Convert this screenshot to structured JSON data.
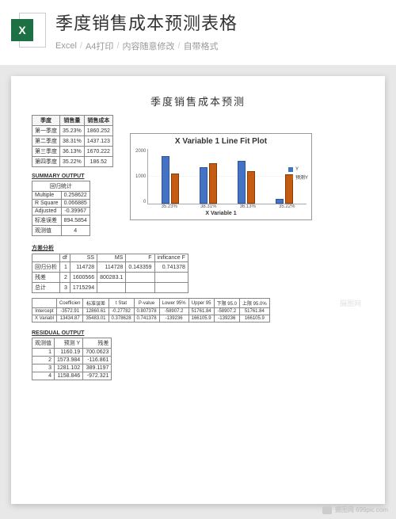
{
  "header": {
    "excel_letter": "X",
    "title": "季度销售成本预测表格",
    "sub1": "Excel",
    "sub2": "A4打印",
    "sub3": "内容随意修改",
    "sub4": "自带格式"
  },
  "sheet": {
    "title": "季度销售成本预测",
    "data_headers": {
      "c1": "季度",
      "c2": "销售量",
      "c3": "销售成本"
    },
    "rows": [
      {
        "q": "第一季度",
        "v": "35.23%",
        "c": "1860.252"
      },
      {
        "q": "第二季度",
        "v": "38.31%",
        "c": "1437.123"
      },
      {
        "q": "第三季度",
        "v": "36.13%",
        "c": "1670.222"
      },
      {
        "q": "第四季度",
        "v": "35.22%",
        "c": "186.52"
      }
    ],
    "summary_h": "SUMMARY OUTPUT",
    "reg_h": "回归统计",
    "reg": [
      {
        "k": "Multiple",
        "v": "0.258622"
      },
      {
        "k": "R Square",
        "v": "0.066885"
      },
      {
        "k": "Adjusted",
        "v": "-0.39967"
      },
      {
        "k": "标准误差",
        "v": "894.5854"
      },
      {
        "k": "观测值",
        "v": "4"
      }
    ],
    "anova_h": "方差分析",
    "anova_headers": {
      "c1": "",
      "c2": "df",
      "c3": "SS",
      "c4": "MS",
      "c5": "F",
      "c6": "inificance F"
    },
    "anova": [
      {
        "n": "回归分析",
        "df": "1",
        "ss": "114728",
        "ms": "114728",
        "f": "0.143359",
        "sig": "0.741378"
      },
      {
        "n": "残差",
        "df": "2",
        "ss": "1600566",
        "ms": "800283.1",
        "f": "",
        "sig": ""
      },
      {
        "n": "总计",
        "df": "3",
        "ss": "1715294",
        "ms": "",
        "f": "",
        "sig": ""
      }
    ],
    "coef_headers": {
      "c1": "",
      "c2": "Coefficien",
      "c3": "标准误差",
      "c4": "t Stat",
      "c5": "P-value",
      "c6": "Lower 95%",
      "c7": "Upper 95",
      "c8": "下限 95.0",
      "c9": "上限 95.0%"
    },
    "coef": [
      {
        "n": "Intercept",
        "a": "-3572.91",
        "b": "12860.61",
        "c": "-0.27782",
        "d": "0.807378",
        "e": "-58907.2",
        "f": "51761.84",
        "g": "-58907.2",
        "h": "51761.84"
      },
      {
        "n": "X Variabl",
        "a": "13434.87",
        "b": "35483.01",
        "c": "0.378628",
        "d": "0.741378",
        "e": "-139236",
        "f": "166105.9",
        "g": "-139236",
        "h": "166105.9"
      }
    ],
    "resid_h": "RESIDUAL OUTPUT",
    "resid_headers": {
      "c1": "观测值",
      "c2": "预测 Y",
      "c3": "残差"
    },
    "resid": [
      {
        "o": "1",
        "p": "1160.19",
        "r": "700.0623"
      },
      {
        "o": "2",
        "p": "1573.984",
        "r": "-116.861"
      },
      {
        "o": "3",
        "p": "1281.102",
        "r": "389.1197"
      },
      {
        "o": "4",
        "p": "1158.846",
        "r": "-972.321"
      }
    ]
  },
  "chart_data": {
    "type": "bar",
    "title": "X Variable 1 Line Fit  Plot",
    "categories": [
      "35.23%",
      "38.31%",
      "36.13%",
      "35.22%"
    ],
    "series": [
      {
        "name": "Y",
        "values": [
          1860,
          1437,
          1670,
          187
        ]
      },
      {
        "name": "预测Y",
        "values": [
          1160,
          1574,
          1281,
          1159
        ]
      }
    ],
    "xlabel": "X Variable 1",
    "ylabel": "",
    "ylim": [
      0,
      2000
    ],
    "yticks": [
      "2000",
      "1000",
      "0"
    ]
  },
  "watermark": {
    "w1": "摄图网",
    "footer": "摄图网 699pic.com"
  }
}
